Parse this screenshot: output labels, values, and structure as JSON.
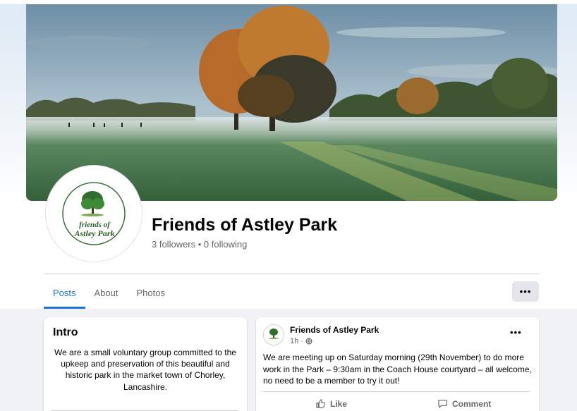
{
  "page": {
    "name": "Friends of Astley Park",
    "stats": "3 followers • 0 following",
    "logo_text_line1": "friends of",
    "logo_text_line2": "Astley Park"
  },
  "tabs": [
    {
      "label": "Posts",
      "active": true
    },
    {
      "label": "About",
      "active": false
    },
    {
      "label": "Photos",
      "active": false
    }
  ],
  "more_button": {
    "label": "•••",
    "icon": "more-horizontal-icon"
  },
  "intro": {
    "title": "Intro",
    "text": "We are a small voluntary group committed to the upkeep and preservation of this beautiful and historic park in the market town of Chorley, Lancashire."
  },
  "post": {
    "author": "Friends of Astley Park",
    "time": "1h",
    "audience_icon": "globe-icon",
    "text": "We are meeting up on Saturday morning (29th November) to do more work in the Park – 9:30am in the Coach House courtyard – all welcome, no need to be a member to try it out!",
    "like_label": "Like",
    "comment_label": "Comment",
    "more_label": "•••"
  },
  "colors": {
    "accent": "#1b74e4",
    "secondary_text": "#65676b",
    "feed_background": "#f0f2f5"
  }
}
